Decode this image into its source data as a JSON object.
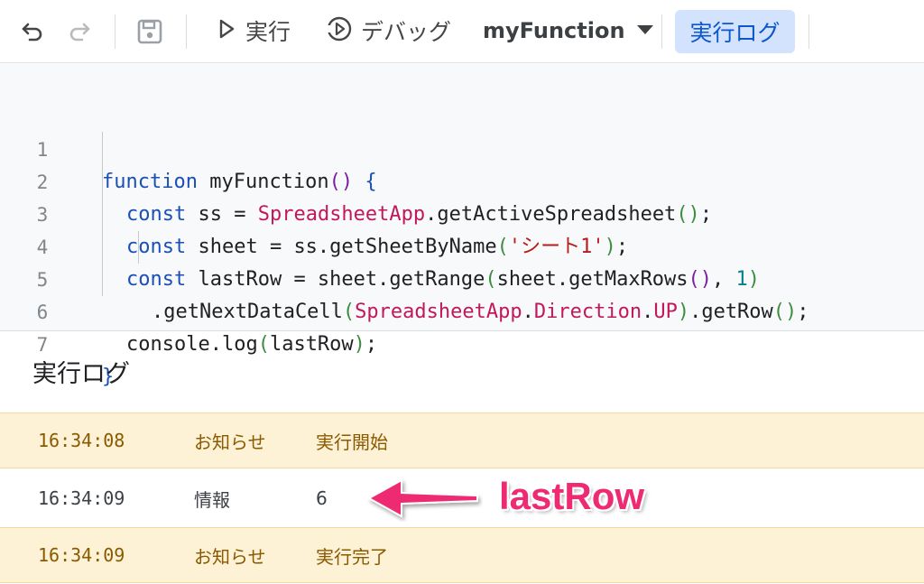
{
  "toolbar": {
    "run_label": "実行",
    "debug_label": "デバッグ",
    "function_select": "myFunction",
    "log_button": "実行ログ"
  },
  "editor": {
    "lines": [
      {
        "number": "1"
      },
      {
        "number": "2"
      },
      {
        "number": "3"
      },
      {
        "number": "4"
      },
      {
        "number": "5"
      },
      {
        "number": "6"
      },
      {
        "number": "7"
      }
    ],
    "tokens": {
      "l1_kw": "function",
      "l1_rest": " myFunction",
      "l1_p": "()",
      "l1_b": " {",
      "l2_kw": "const",
      "l2_a": " ss = ",
      "l2_cls": "SpreadsheetApp",
      "l2_b": ".getActiveSpreadsheet",
      "l2_p": "()",
      "l2_e": ";",
      "l3_kw": "const",
      "l3_a": " sheet = ss.getSheetByName",
      "l3_po": "(",
      "l3_str": "'シート1'",
      "l3_pc": ")",
      "l3_e": ";",
      "l4_kw": "const",
      "l4_a": " lastRow = sheet.getRange",
      "l4_po": "(",
      "l4_b": "sheet.getMaxRows",
      "l4_pp": "()",
      "l4_c": ", ",
      "l4_num": "1",
      "l4_pc": ")",
      "l5_a": ".getNextDataCell",
      "l5_po": "(",
      "l5_cls1": "SpreadsheetApp",
      "l5_d": ".",
      "l5_cls2": "Direction",
      "l5_d2": ".",
      "l5_cls3": "UP",
      "l5_pc": ")",
      "l5_b": ".getRow",
      "l5_pp": "()",
      "l5_e": ";",
      "l6_a": "console.log",
      "l6_po": "(",
      "l6_b": "lastRow",
      "l6_pc": ")",
      "l6_e": ";",
      "l7_b": "}"
    }
  },
  "log_panel": {
    "title": "実行ログ",
    "rows": [
      {
        "time": "16:34:08",
        "type": "お知らせ",
        "message": "実行開始"
      },
      {
        "time": "16:34:09",
        "type": "情報",
        "message": "6"
      },
      {
        "time": "16:34:09",
        "type": "お知らせ",
        "message": "実行完了"
      }
    ]
  },
  "annotation": {
    "label": "lastRow",
    "color": "#ee2a72"
  },
  "colors": {
    "notice_bg": "#fdf1d6",
    "accent_button_bg": "#d3e3fd",
    "keyword": "#1a4fb5",
    "class_name": "#c2185b",
    "string": "#b71c1c"
  }
}
